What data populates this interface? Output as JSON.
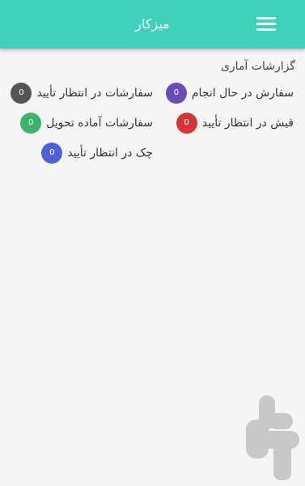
{
  "appbar": {
    "title": "میزکار",
    "menu_icon": "hamburger-menu-icon",
    "color": "#3fd1bb"
  },
  "section": {
    "title": "گزارشات آماری"
  },
  "stats": [
    {
      "label": "سفارش در حال انجام",
      "value": "0",
      "color": "#6b4bb5"
    },
    {
      "label": "سفارشات در انتظار تأیید",
      "value": "0",
      "color": "#555555"
    },
    {
      "label": "فیش در انتظار تأیید",
      "value": "0",
      "color": "#d63535"
    },
    {
      "label": "سفارشات آماده تحویل",
      "value": "0",
      "color": "#3bb36a"
    },
    {
      "label": "چک در انتظار تأیید",
      "value": "0",
      "color": "#4c63d8"
    }
  ],
  "logo": {
    "icon": "app-logo-icon",
    "color": "#c8c8c8"
  }
}
